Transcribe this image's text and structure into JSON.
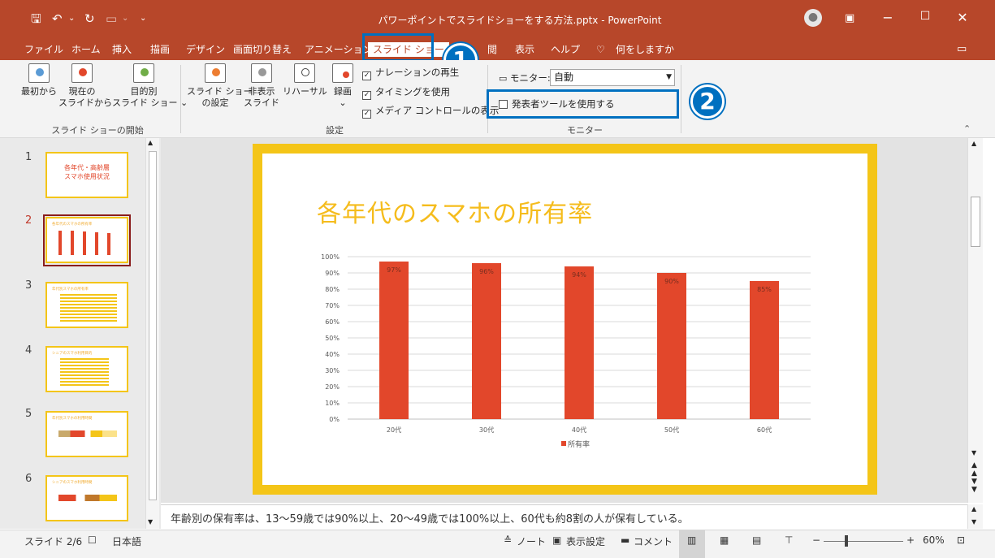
{
  "window": {
    "title": "パワーポイントでスライドショーをする方法.pptx  -  PowerPoint",
    "minimize": "−",
    "maximize": "☐",
    "close": "✕"
  },
  "tabs": [
    "ファイル",
    "ホーム",
    "挿入",
    "描画",
    "デザイン",
    "画面切り替え",
    "アニメーション",
    "スライド ショー",
    "閲",
    "表示",
    "ヘルプ",
    "何をしますか"
  ],
  "ribbon": {
    "start_group": {
      "label": "スライド ショーの開始",
      "from_start": "最初から",
      "from_current_1": "現在の",
      "from_current_2": "スライドから",
      "custom_1": "目的別",
      "custom_2": "スライド ショー ⌄"
    },
    "settings_group": {
      "label": "設定",
      "setup_1": "スライド ショー",
      "setup_2": "の設定",
      "hide_1": "非表示",
      "hide_2": "スライド",
      "rehearse": "リハーサル",
      "record": "録画",
      "record_caret": "⌄",
      "chk_narration": "ナレーションの再生",
      "chk_timing": "タイミングを使用",
      "chk_media": "メディア コントロールの表示",
      "check_mark": "✓"
    },
    "monitor_group": {
      "label": "モニター",
      "monitor_label": "モニター:",
      "monitor_value": "自動",
      "presenter_view": "発表者ツールを使用する"
    }
  },
  "callouts": {
    "one": "1",
    "two": "2"
  },
  "thumbnails": [
    {
      "num": "1",
      "line1": "各年代・高齢層",
      "line2": "スマホ使用状況"
    },
    {
      "num": "2",
      "title": "各年代のスマホの所有率"
    },
    {
      "num": "3",
      "title": "年代別スマホの所有率"
    },
    {
      "num": "4",
      "title": "シニアのスマホ利用目的"
    },
    {
      "num": "5",
      "title": "年代別スマホの利用時間"
    },
    {
      "num": "6",
      "title": "シニアのスマホ利用時間"
    }
  ],
  "slide": {
    "title": "各年代のスマホの所有率"
  },
  "chart_data": {
    "type": "bar",
    "title": "各年代のスマホの所有率",
    "categories": [
      "20代",
      "30代",
      "40代",
      "50代",
      "60代"
    ],
    "series": [
      {
        "name": "所有率",
        "values": [
          97,
          96,
          94,
          90,
          85
        ]
      }
    ],
    "data_labels": [
      "97%",
      "96%",
      "94%",
      "90%",
      "85%"
    ],
    "y_ticks": [
      "0%",
      "10%",
      "20%",
      "30%",
      "40%",
      "50%",
      "60%",
      "70%",
      "80%",
      "90%",
      "100%"
    ],
    "ylim": [
      0,
      100
    ],
    "grid": true,
    "legend_position": "bottom",
    "bar_color": "#e2472b"
  },
  "notes": "年齢別の保有率は、13～59歳では90%以上、20～49歳では100%以上、60代も約8割の人が保有している。",
  "status": {
    "slide_info": "スライド 2/6",
    "language": "日本語",
    "notes_btn": "ノート",
    "display_settings": "表示設定",
    "comments": "コメント",
    "zoom": "60%",
    "zoom_minus": "−",
    "zoom_plus": "+"
  }
}
